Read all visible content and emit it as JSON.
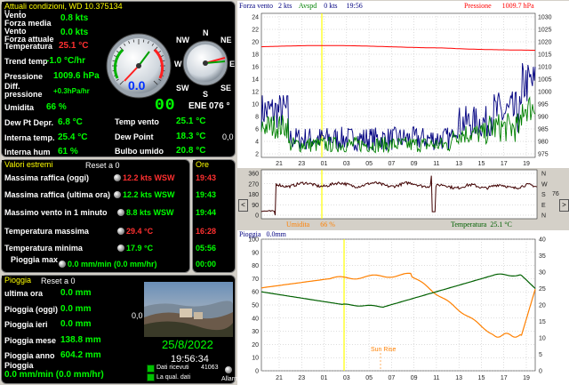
{
  "current": {
    "title": "Attuali condizioni, WD 10.375134",
    "rows": [
      {
        "label": "Vento\nForza media",
        "value": "0.8 kts",
        "color": "g"
      },
      {
        "label": "Vento\nForza attuale",
        "value": "0.0 kts",
        "color": "g"
      },
      {
        "label": "Temperatura",
        "value": "25.1 °C",
        "color": "r"
      },
      {
        "label": "Trend temp",
        "value": "-1.0 °C/hr",
        "color": "g"
      },
      {
        "label": "Pressione",
        "value": "1009.6 hPa",
        "color": "g"
      },
      {
        "label": "Diff.\npressione",
        "value": "+0.3hPa/hr",
        "color": "g"
      },
      {
        "label": "Umidita",
        "value": "66 %",
        "color": "g"
      }
    ],
    "gauge_value": "0.0",
    "compass": {
      "n": "N",
      "s": "S",
      "e": "E",
      "w": "W",
      "ne": "NE",
      "nw": "NW",
      "se": "SE",
      "sw": "SW"
    },
    "direction_text": "ENE",
    "direction_deg": "076 °",
    "digit_display": "00",
    "dew_pt_depr_label": "Dew Pt Depr.",
    "dew_pt_depr_value": "6.8 °C",
    "interna_temp_label": "Interna temp.",
    "interna_temp_value": "25.4 °C",
    "interna_hum_label": "Interna hum",
    "interna_hum_value": "61 %",
    "temp_vento_label": "Temp vento",
    "temp_vento_value": "25.1 °C",
    "dew_point_label": "Dew Point",
    "dew_point_value": "18.3 °C",
    "bulbo_label": "Bulbo umido",
    "bulbo_value": "20.8 °C",
    "side_value": "0,0"
  },
  "extremes": {
    "title": "Valori estremi",
    "reset": "Reset a 0",
    "rows": [
      {
        "label": "Massima raffica (oggi)",
        "value": "12.2 kts WSW",
        "color": "r"
      },
      {
        "label": "Massima raffica (ultima ora)",
        "value": "12.2 kts WSW",
        "color": "g"
      },
      {
        "label": "Massimo vento in 1 minuto",
        "value": "8.8 kts WSW",
        "color": "g"
      },
      {
        "label": "Temperatura massima",
        "value": "29.4 °C",
        "color": "r"
      },
      {
        "label": "Temperatura minima",
        "value": "17.9 °C",
        "color": "g"
      }
    ],
    "rain_max_label": "Pioggia max",
    "rain_max_value": "0.0 mm/min (0.0 mm/hr)"
  },
  "times": {
    "title": "Ore",
    "values": [
      "19:43",
      "19:43",
      "19:44",
      "16:28",
      "05:56",
      "00:00"
    ],
    "colors": [
      "r",
      "g",
      "g",
      "r",
      "g",
      "g"
    ]
  },
  "rain": {
    "title": "Pioggia",
    "reset": "Reset a 0",
    "rows": [
      {
        "label": "ultima ora",
        "value": "0.0 mm"
      },
      {
        "label": "Pioggia (oggi)",
        "value": "0.0 mm"
      },
      {
        "label": "Pioggia ieri",
        "value": "0.0 mm"
      },
      {
        "label": "Pioggia mese",
        "value": "138.8 mm"
      },
      {
        "label": "Pioggia anno",
        "value": "604.2 mm"
      }
    ],
    "rate_label": "Pioggia",
    "rate_value": "0.0 mm/min (0.0 mm/hr)",
    "side_value": "0,0"
  },
  "photo": {
    "date": "25/8/2022",
    "time": "19:56:34",
    "check1": "Dati ricevuti",
    "check2": "La qual. dati",
    "count": "41063",
    "allarm": "Allarmi"
  },
  "graph1": {
    "label_wind": "Forza vento",
    "label_wind_val": "2 kts",
    "label_avg": "Avspd",
    "label_avg_val": "0 kts",
    "label_time": "19:56",
    "label_press": "Pressione",
    "label_press_val": "1009.7 hPa",
    "left_ticks": [
      "24",
      "22",
      "20",
      "18",
      "16",
      "14",
      "12",
      "10",
      "8",
      "6",
      "4",
      "2"
    ],
    "right_ticks": [
      "1030",
      "1025",
      "1020",
      "1015",
      "1010",
      "1005",
      "1000",
      "995",
      "990",
      "985",
      "980",
      "975"
    ],
    "x_ticks": [
      "21",
      "23",
      "01",
      "03",
      "05",
      "07",
      "09",
      "11",
      "13",
      "15",
      "17",
      "19"
    ]
  },
  "graph2": {
    "left_ticks": [
      "360",
      "270",
      "180",
      "90",
      "0"
    ],
    "compass_letters": [
      "N",
      "W",
      "S",
      "E",
      "N"
    ],
    "side_value": "76",
    "label_hum": "Umidita",
    "label_hum_val": "66 %",
    "label_temp": "Temperatura",
    "label_temp_val": "25.1 °C",
    "nav_left": "<",
    "nav_right": ">"
  },
  "graph3": {
    "label_rain": "Pioggia",
    "label_rain_val": "0.0mm",
    "left_ticks": [
      "100",
      "90",
      "80",
      "70",
      "60",
      "50",
      "40",
      "30",
      "20",
      "10",
      "0"
    ],
    "right_ticks": [
      "40",
      "35",
      "30",
      "25",
      "20",
      "15",
      "10",
      "5",
      "0"
    ],
    "x_ticks": [
      "21",
      "23",
      "01",
      "03",
      "05",
      "07",
      "09",
      "11",
      "13",
      "15",
      "17",
      "19"
    ],
    "sun_rise": "Sun Rise"
  },
  "colors": {
    "wind_blue": "#000080",
    "wind_green": "#008000",
    "pressure": "#ff0000",
    "humidity": "#ff8000",
    "temperature": "#006000",
    "direction": "#400000"
  }
}
